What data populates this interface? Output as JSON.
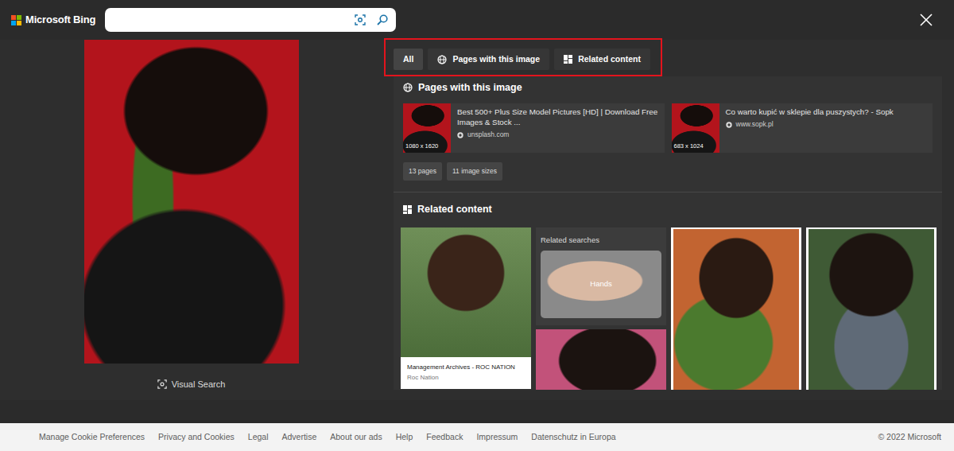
{
  "header": {
    "logo": "Microsoft Bing"
  },
  "viewer": {
    "visual_search": "Visual Search"
  },
  "tabs": [
    {
      "label": "All",
      "selected": true
    },
    {
      "label": "Pages with this image",
      "selected": false
    },
    {
      "label": "Related content",
      "selected": false
    }
  ],
  "pages": {
    "title": "Pages with this image",
    "items": [
      {
        "title": "Best 500+ Plus Size Model Pictures [HD] | Download Free Images & Stock ...",
        "domain": "unsplash.com",
        "size": "1080 x 1620"
      },
      {
        "title": "Co warto kupić w sklepie dla puszystych? - Sopk",
        "domain": "www.sopk.pl",
        "size": "683 x 1024"
      }
    ],
    "chips": [
      "13 pages",
      "11 image sizes"
    ]
  },
  "related": {
    "title": "Related content",
    "items": [
      {
        "kind": "captioned",
        "caption": "Management Archives - ROC NATION",
        "source": "Roc Nation"
      },
      {
        "kind": "searches",
        "label": "Related searches",
        "searches": [
          "Hands"
        ]
      },
      {
        "kind": "image"
      },
      {
        "kind": "image"
      }
    ]
  },
  "footer": {
    "links": [
      "Manage Cookie Preferences",
      "Privacy and Cookies",
      "Legal",
      "Advertise",
      "About our ads",
      "Help",
      "Feedback",
      "Impressum",
      "Datenschutz in Europa"
    ],
    "copyright": "© 2022 Microsoft"
  }
}
